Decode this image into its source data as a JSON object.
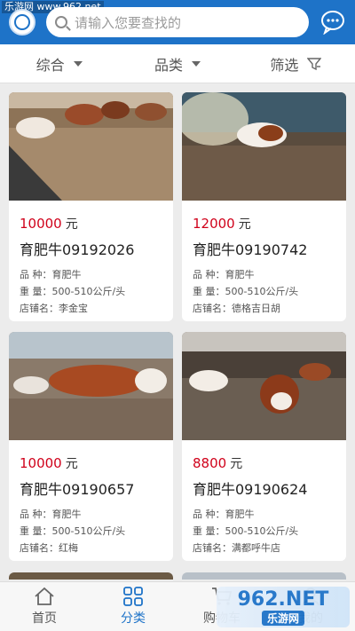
{
  "watermark_top": "乐游网 www.962.net",
  "search": {
    "placeholder": "请输入您要查找的"
  },
  "filters": [
    {
      "label": "综合",
      "icon": "caret-down-icon"
    },
    {
      "label": "品类",
      "icon": "caret-down-icon"
    },
    {
      "label": "筛选",
      "icon": "funnel-icon"
    }
  ],
  "products": [
    {
      "price": "10000",
      "unit": "元",
      "title": "育肥牛09192026",
      "breed_label": "品 种：",
      "breed": "育肥牛",
      "weight_label": "重 量：",
      "weight": "500-510公斤/头",
      "store_label": "店铺名：",
      "store": "李金宝"
    },
    {
      "price": "12000",
      "unit": "元",
      "title": "育肥牛09190742",
      "breed_label": "品 种：",
      "breed": "育肥牛",
      "weight_label": "重 量：",
      "weight": "500-510公斤/头",
      "store_label": "店铺名：",
      "store": "德格吉日胡"
    },
    {
      "price": "10000",
      "unit": "元",
      "title": "育肥牛09190657",
      "breed_label": "品 种：",
      "breed": "育肥牛",
      "weight_label": "重 量：",
      "weight": "500-510公斤/头",
      "store_label": "店铺名：",
      "store": "红梅"
    },
    {
      "price": "8800",
      "unit": "元",
      "title": "育肥牛09190624",
      "breed_label": "品 种：",
      "breed": "育肥牛",
      "weight_label": "重 量：",
      "weight": "500-510公斤/头",
      "store_label": "店铺名：",
      "store": "满都呼牛店"
    }
  ],
  "bottom_nav": [
    {
      "label": "首页",
      "icon": "home-icon"
    },
    {
      "label": "分类",
      "icon": "category-icon",
      "active": true
    },
    {
      "label": "购物车",
      "icon": "cart-icon"
    },
    {
      "label": "我的",
      "icon": "user-icon"
    }
  ],
  "watermark_bottom": {
    "main": "962.NET",
    "sub": "乐游网"
  },
  "colors": {
    "brand": "#1e73c8",
    "price": "#d0021b"
  }
}
